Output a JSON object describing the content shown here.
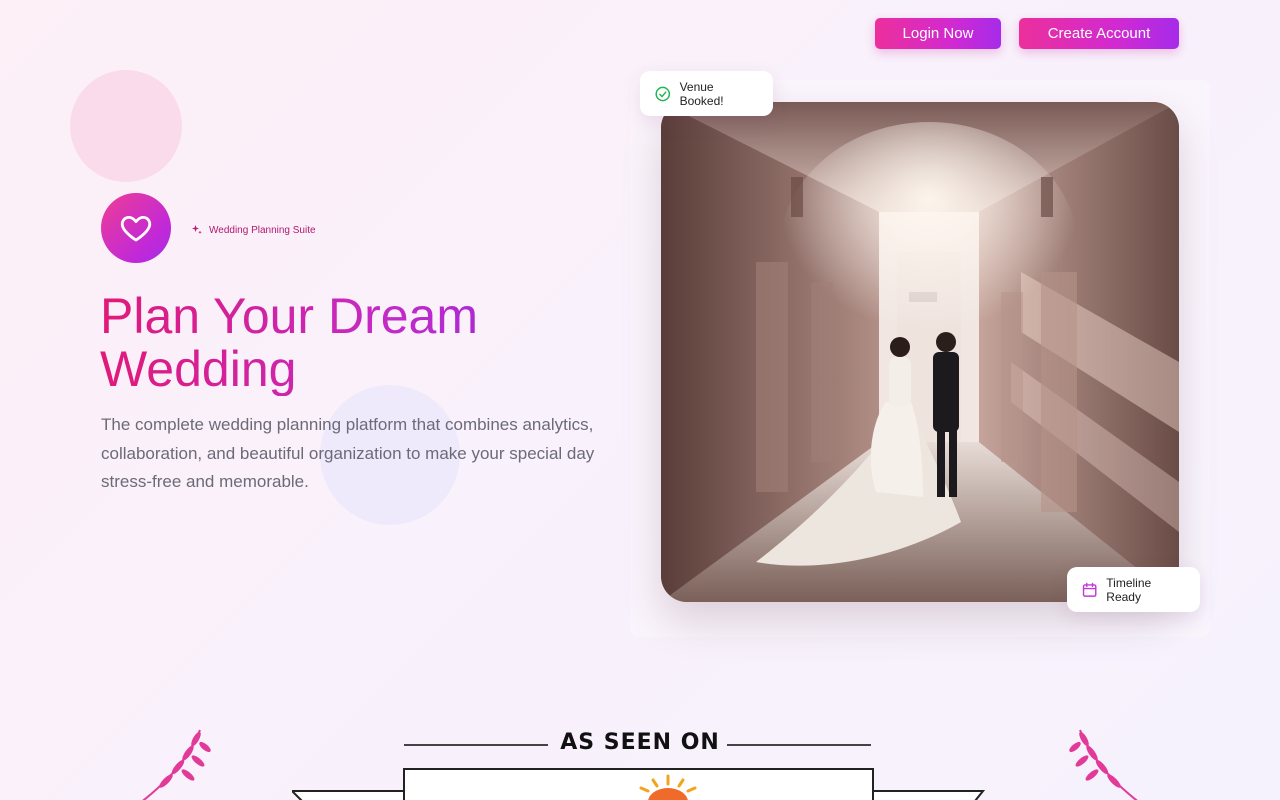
{
  "nav": {
    "login_label": "Login Now",
    "create_label": "Create Account"
  },
  "hero": {
    "tag": "Wedding Planning Suite",
    "title_line1": "Plan Your Dream",
    "title_line2": "Wedding",
    "description": "The complete wedding planning platform that combines analytics, collaboration, and beautiful organization to make your special day stress-free and memorable."
  },
  "badges": {
    "venue": "Venue Booked!",
    "timeline": "Timeline Ready"
  },
  "press": {
    "heading": "AS SEEN ON"
  },
  "icons": {
    "logo": "heart-icon",
    "tag": "sparkles-icon",
    "venue": "check-circle-icon",
    "timeline": "calendar-icon"
  },
  "colors": {
    "brand_pink": "#ec2f9b",
    "brand_purple": "#a62bea",
    "success_green": "#22b455"
  }
}
